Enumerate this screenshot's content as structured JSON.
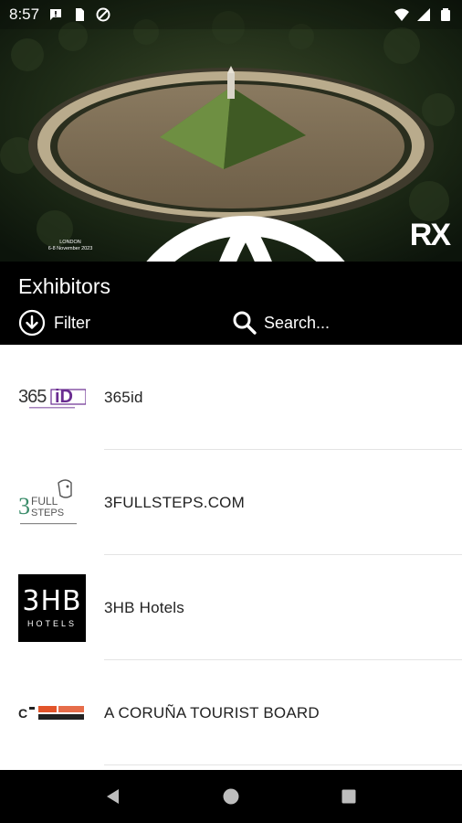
{
  "status_bar": {
    "time": "8:57",
    "left_icons": [
      "message-icon",
      "sim-card-icon",
      "data-saver-icon"
    ],
    "right_icons": [
      "wifi-icon",
      "signal-icon",
      "battery-icon"
    ]
  },
  "hero": {
    "wtm_logo_text": "wtm",
    "wtm_sub_line1": "LONDON",
    "wtm_sub_line2": "6-8 November 2023",
    "rx_logo_text": "RX"
  },
  "header": {
    "title": "Exhibitors",
    "filter_label": "Filter",
    "search_label": "Search..."
  },
  "exhibitors": [
    {
      "name": "365id",
      "logo": "365id-logo"
    },
    {
      "name": "3FULLSTEPS.COM",
      "logo": "3fullsteps-logo"
    },
    {
      "name": "3HB Hotels",
      "logo": "3hb-hotels-logo",
      "logo_big": "3HB",
      "logo_small": "HOTELS"
    },
    {
      "name": "A CORUÑA TOURIST BOARD",
      "logo": "a-coruna-logo"
    }
  ],
  "nav": {
    "icons": [
      "back-icon",
      "home-icon",
      "recents-icon"
    ]
  }
}
